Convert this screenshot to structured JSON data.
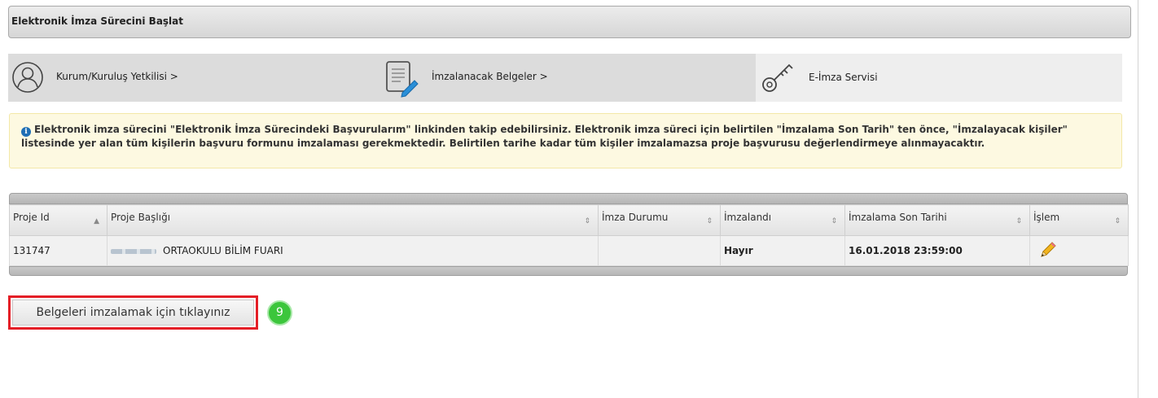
{
  "panel": {
    "title": "Elektronik İmza Sürecini Başlat"
  },
  "steps": [
    {
      "label": "Kurum/Kuruluş Yetkilisi >",
      "icon": "user-icon"
    },
    {
      "label": "İmzalanacak Belgeler >",
      "icon": "document-edit-icon"
    },
    {
      "label": "E-İmza Servisi",
      "icon": "key-icon"
    }
  ],
  "info": {
    "icon": "info-icon",
    "text": "Elektronik imza sürecini \"Elektronik İmza Sürecindeki Başvurularım\" linkinden takip edebilirsiniz. Elektronik imza süreci için belirtilen \"İmzalama Son Tarih\" ten önce, \"İmzalayacak kişiler\" listesinde yer alan tüm kişilerin başvuru formunu imzalaması gerekmektedir. Belirtilen tarihe kadar tüm kişiler imzalamazsa proje başvurusu değerlendirmeye alınmayacaktır."
  },
  "table": {
    "columns": [
      "Proje Id",
      "Proje Başlığı",
      "İmza Durumu",
      "İmzalandı",
      "İmzalama Son Tarihi",
      "İşlem"
    ],
    "rows": [
      {
        "id": "131747",
        "title": "ORTAOKULU BİLİM FUARI",
        "status": "",
        "signed": "Hayır",
        "deadline": "16.01.2018 23:59:00",
        "action_icon": "pencil-icon"
      }
    ]
  },
  "action": {
    "label": "Belgeleri imzalamak için tıklayınız",
    "badge": "9"
  },
  "colors": {
    "highlight": "#e41e26",
    "badge": "#3cc63c",
    "info_bg": "#fdf9e1"
  }
}
